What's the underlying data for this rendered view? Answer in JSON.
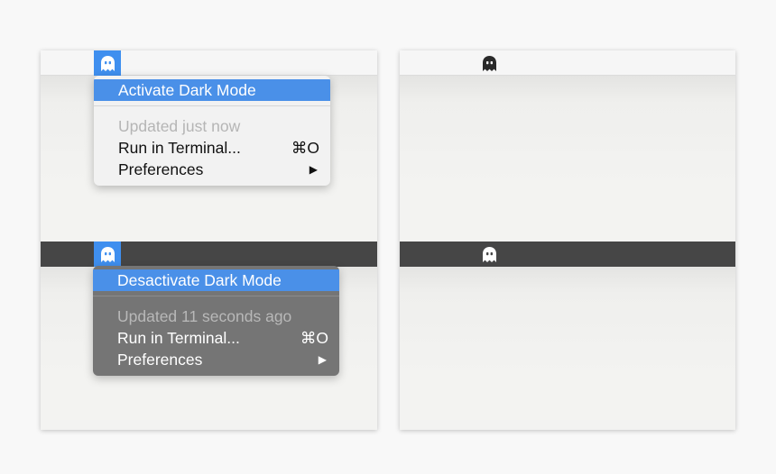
{
  "colors": {
    "accent": "#4a90e8",
    "light_menubar": "#f6f6f6",
    "dark_menubar": "#464646",
    "dark_menu": "#757575"
  },
  "icons": {
    "status_item": "ghost-icon"
  },
  "light_menu": {
    "activate_label": "Activate Dark Mode",
    "status_text": "Updated just now",
    "run_label": "Run in Terminal...",
    "run_shortcut": "⌘O",
    "preferences_label": "Preferences",
    "submenu_arrow": "▶"
  },
  "dark_menu": {
    "deactivate_label": "Desactivate Dark Mode",
    "status_text": "Updated 11 seconds ago",
    "run_label": "Run in Terminal...",
    "run_shortcut": "⌘O",
    "preferences_label": "Preferences",
    "submenu_arrow": "▶"
  }
}
